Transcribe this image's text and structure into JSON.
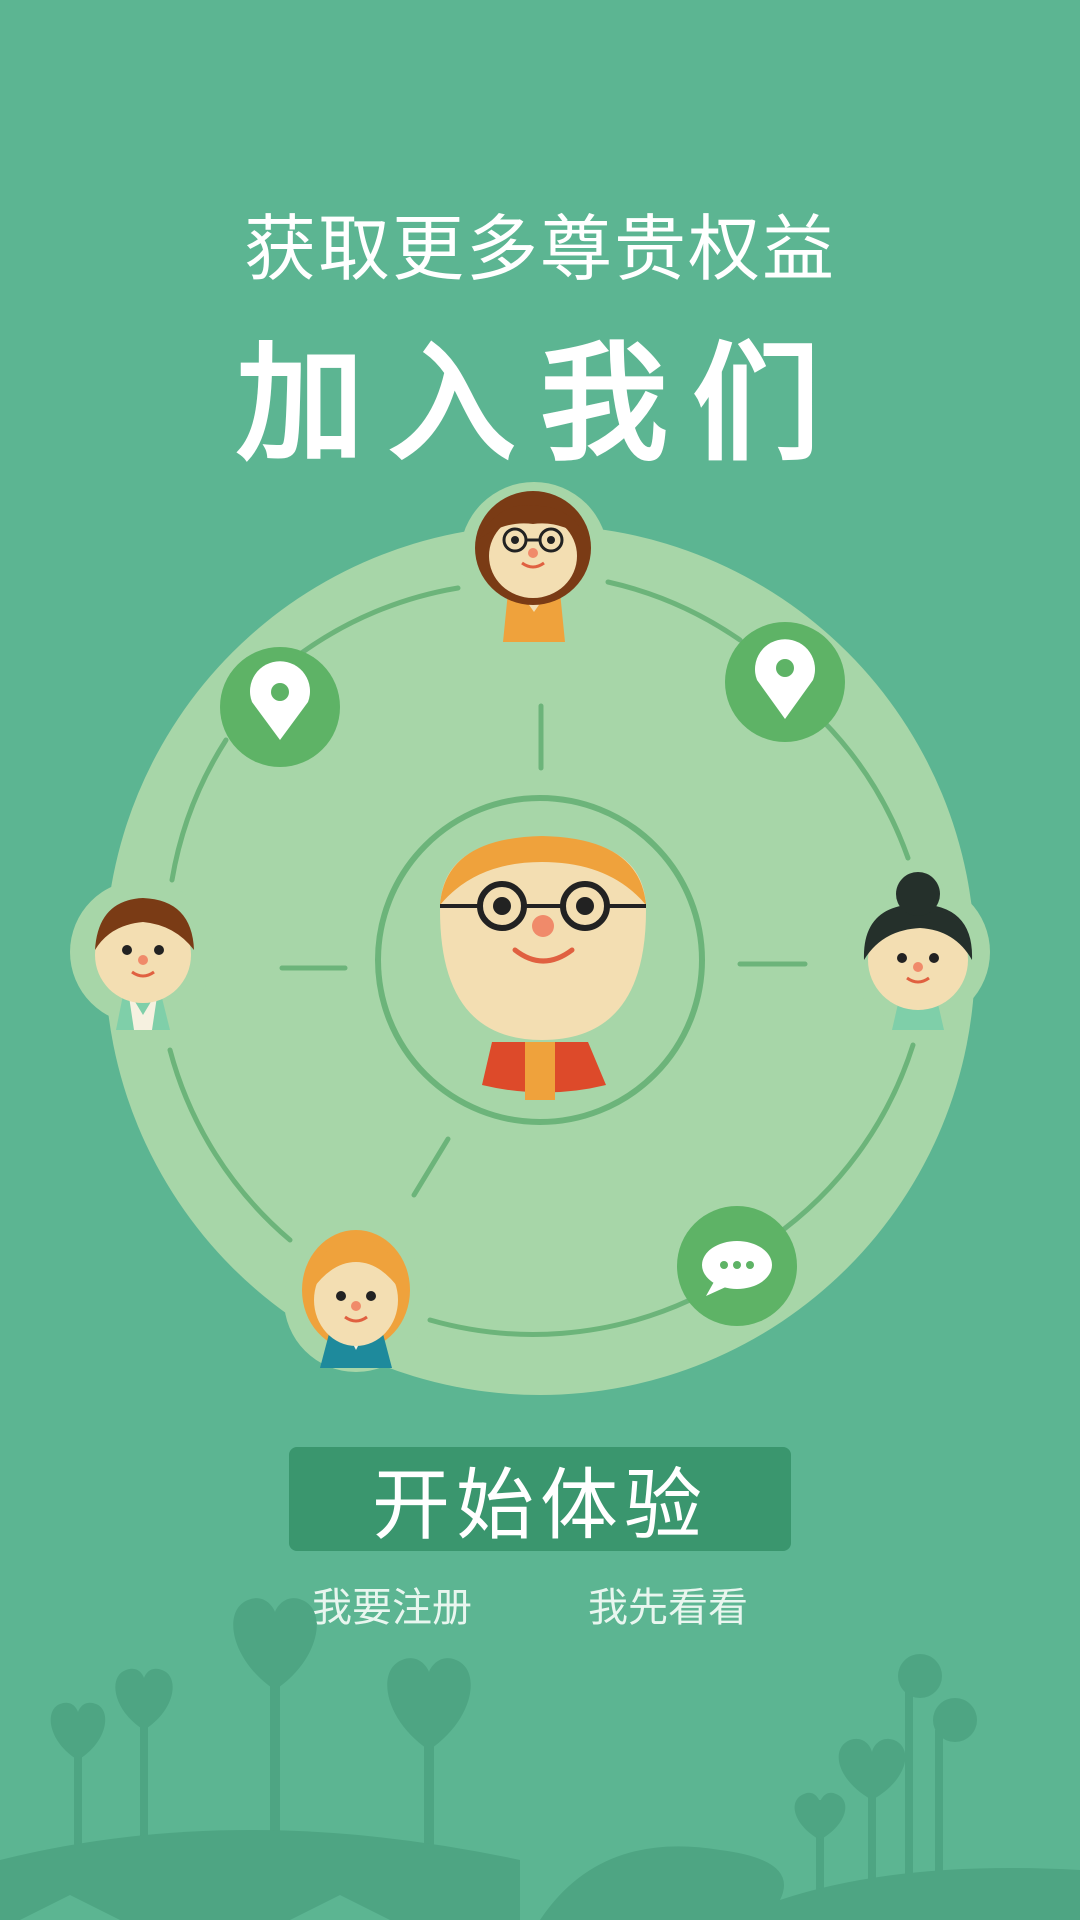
{
  "header": {
    "subtitle": "获取更多尊贵权益",
    "title": "加入我们"
  },
  "actions": {
    "start_label": "开始体验",
    "register_label": "我要注册",
    "browse_label": "我先看看"
  },
  "icons": [
    "location-pin-icon",
    "location-pin-icon",
    "chat-bubble-icon"
  ],
  "colors": {
    "background": "#5cb592",
    "disc": "#a7d6a8",
    "ring": "#6cb47a",
    "badge": "#5eb366",
    "button": "#3a966e",
    "text": "#ffffff"
  }
}
